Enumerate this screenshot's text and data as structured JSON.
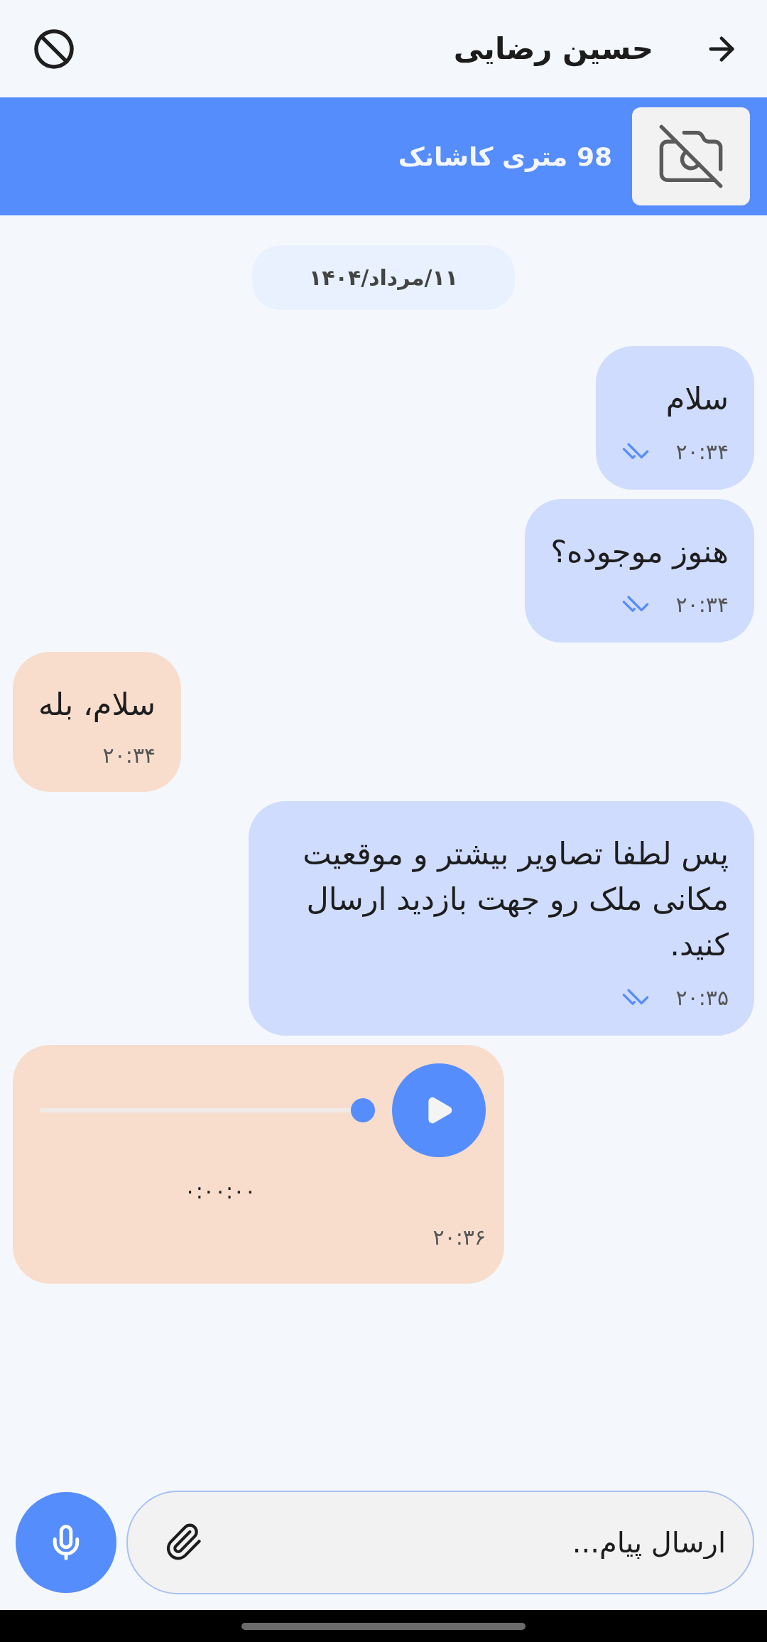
{
  "header": {
    "title": "حسین رضایی"
  },
  "listing": {
    "title": "98 متری کاشانک"
  },
  "date_chip": "۱۱/مرداد/۱۴۰۴",
  "messages": [
    {
      "kind": "text",
      "outgoing": true,
      "text": "سلام",
      "time": "۲۰:۳۴",
      "read": true
    },
    {
      "kind": "text",
      "outgoing": true,
      "text": "هنوز موجوده؟",
      "time": "۲۰:۳۴",
      "read": true
    },
    {
      "kind": "text",
      "outgoing": false,
      "text": "سلام، بله",
      "time": "۲۰:۳۴"
    },
    {
      "kind": "text",
      "outgoing": true,
      "text": "پس لطفا تصاویر بیشتر و موقعیت مکانی ملک رو جهت بازدید ارسال کنید.",
      "time": "۲۰:۳۵",
      "read": true
    },
    {
      "kind": "voice",
      "outgoing": false,
      "duration": "۰:۰۰:۰۰",
      "time": "۲۰:۳۶"
    }
  ],
  "composer": {
    "placeholder": "ارسال پیام..."
  }
}
